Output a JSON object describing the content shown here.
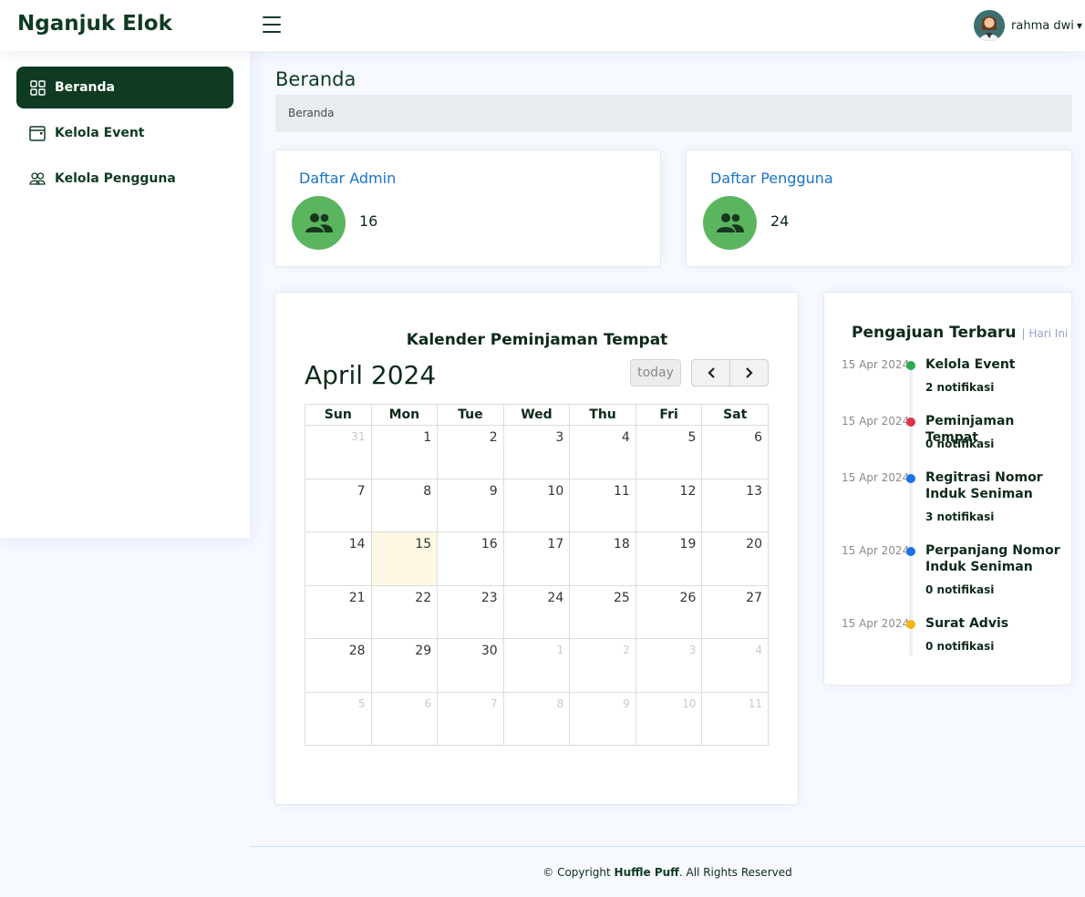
{
  "header": {
    "brand": "Nganjuk Elok",
    "menu_icon": "hamburger-icon",
    "user": {
      "name": "rahma dwi"
    }
  },
  "sidebar": {
    "items": [
      {
        "label": "Beranda",
        "icon": "grid-icon",
        "active": true
      },
      {
        "label": "Kelola Event",
        "icon": "calendar-icon",
        "active": false
      },
      {
        "label": "Kelola Pengguna",
        "icon": "people-icon",
        "active": false
      }
    ]
  },
  "page": {
    "title": "Beranda",
    "breadcrumb": "Beranda"
  },
  "stats": [
    {
      "title": "Daftar Admin",
      "value": "16",
      "icon": "users-icon"
    },
    {
      "title": "Daftar Pengguna",
      "value": "24",
      "icon": "users-icon"
    }
  ],
  "calendar": {
    "heading": "Kalender Peminjaman Tempat",
    "month": "April 2024",
    "today_label": "today",
    "prev_icon": "chevron-left-icon",
    "next_icon": "chevron-right-icon",
    "weekdays": [
      "Sun",
      "Mon",
      "Tue",
      "Wed",
      "Thu",
      "Fri",
      "Sat"
    ],
    "weeks": [
      [
        "31",
        "1",
        "2",
        "3",
        "4",
        "5",
        "6"
      ],
      [
        "7",
        "8",
        "9",
        "10",
        "11",
        "12",
        "13"
      ],
      [
        "14",
        "15",
        "16",
        "17",
        "18",
        "19",
        "20"
      ],
      [
        "21",
        "22",
        "23",
        "24",
        "25",
        "26",
        "27"
      ],
      [
        "28",
        "29",
        "30",
        "1",
        "2",
        "3",
        "4"
      ],
      [
        "5",
        "6",
        "7",
        "8",
        "9",
        "10",
        "11"
      ]
    ],
    "today": "15"
  },
  "timeline": {
    "title": "Pengajuan Terbaru",
    "subtitle": "| Hari Ini",
    "items": [
      {
        "date": "15 Apr 2024",
        "name": "Kelola Event",
        "count": "2 notifikasi",
        "color": "#2ea84f"
      },
      {
        "date": "15 Apr 2024",
        "name": "Peminjaman Tempat",
        "count": "0 notifikasi",
        "color": "#dc3545"
      },
      {
        "date": "15 Apr 2024",
        "name": "Regitrasi Nomor Induk Seniman",
        "count": "3 notifikasi",
        "color": "#1a73e8"
      },
      {
        "date": "15 Apr 2024",
        "name": "Perpanjang Nomor Induk Seniman",
        "count": "0 notifikasi",
        "color": "#1a73e8"
      },
      {
        "date": "15 Apr 2024",
        "name": "Surat Advis",
        "count": "0 notifikasi",
        "color": "#f5b70d"
      }
    ]
  },
  "footer": {
    "prefix": "© Copyright",
    "company": "Huffle Puff",
    "suffix": ". All Rights Reserved"
  }
}
